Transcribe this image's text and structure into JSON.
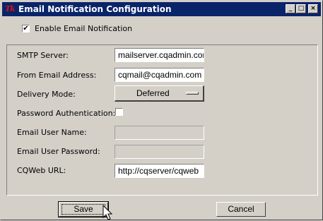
{
  "window": {
    "title": "Email Notification Configuration",
    "app_icon": "Tk",
    "controls": {
      "minimize": "_",
      "maximize": "□",
      "close": "×"
    }
  },
  "enable": {
    "label": "Enable Email Notification",
    "checked": true,
    "mark": "✔"
  },
  "form": {
    "smtp": {
      "label": "SMTP Server:",
      "value": "mailserver.cqadmin.com"
    },
    "from": {
      "label": "From Email Address:",
      "value": "cqmail@cqadmin.com"
    },
    "delivery": {
      "label": "Delivery Mode:",
      "value": "Deferred"
    },
    "password_auth": {
      "label": "Password Authentication:",
      "checked": false
    },
    "user_name": {
      "label": "Email User Name:",
      "value": ""
    },
    "user_password": {
      "label": "Email User Password:",
      "value": ""
    },
    "cqweb": {
      "label": "CQWeb URL:",
      "value": "http://cqserver/cqweb"
    }
  },
  "buttons": {
    "save": "Save",
    "cancel": "Cancel"
  }
}
